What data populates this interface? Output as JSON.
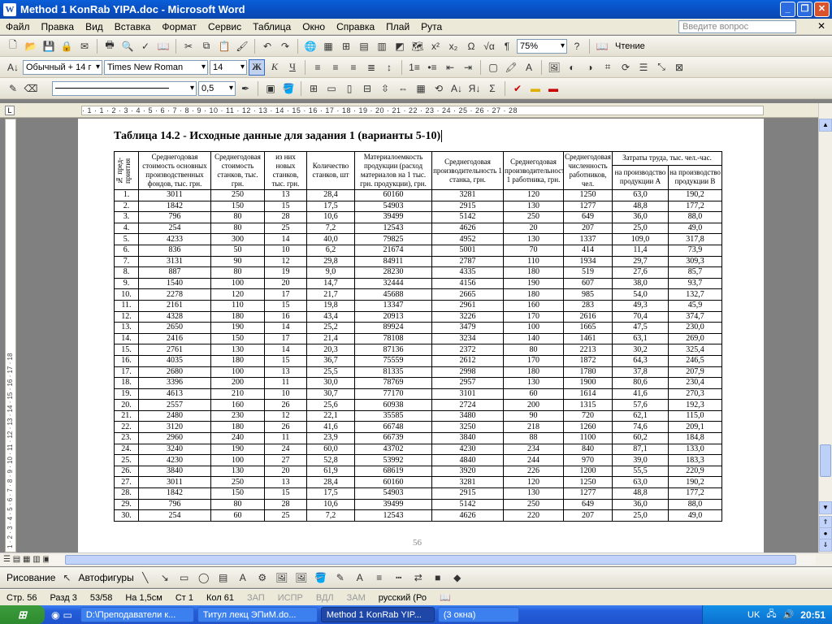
{
  "window": {
    "title": "Method 1 KonRab YIPA.doc - Microsoft Word",
    "app_icon": "W"
  },
  "menu": {
    "items": [
      "Файл",
      "Правка",
      "Вид",
      "Вставка",
      "Формат",
      "Сервис",
      "Таблица",
      "Окно",
      "Справка",
      "Плай",
      "Рута"
    ],
    "help_placeholder": "Введите вопрос"
  },
  "toolbar": {
    "zoom": "75%",
    "read_label": "Чтение",
    "style": "Обычный + 14 г",
    "font": "Times New Roman",
    "size": "14",
    "bold": "Ж",
    "italic": "К",
    "underline": "Ч",
    "line_width": "0,5",
    "accent_color": "#316ac5"
  },
  "ruler": {
    "marks": "· 1 · 1 · 2 · 3 · 4 · 5 · 6 · 7 · 8 · 9 · 10 · 11 · 12 · 13 · 14 · 15 · 16 · 17 · 18 · 19 · 20 · 21 · 22 · 23 · 24 · 25 · 26 · 27 · 28",
    "vmarks": "1 · 2 · 3 · 4 · 5 · 6 · 7 · 8 · 9 · 10 · 11 · 12 · 13 · 14 · 15 · 16 · 17 · 18"
  },
  "document": {
    "heading": "Таблица 14.2 - Исходные данные для задания 1 (варианты 5-10)",
    "page_number": "56",
    "headers": {
      "c1": "№ пред-приятия",
      "c2": "Среднегодовая стоимость основных производственных фондов, тыс. грн.",
      "c3": "Среднегодовая стоимость станков, тыс. грн.",
      "c4": "из них новых станков, тыс. грн.",
      "c5": "Количество станков, шт",
      "c6": "Материалоемкость продукции (расход материалов на 1 тыс. грн. продукции), грн.",
      "c7": "Среднегодовая производительность 1 станка, грн.",
      "c8": "Среднегодовая производительность 1 работника, грн.",
      "c9": "Среднегодовая численность работников, чел.",
      "c10": "Затраты труда, тыс. чел.-час.",
      "c10a": "на производство продукции А",
      "c10b": "на производство продукции В"
    },
    "rows": [
      [
        "1.",
        "3011",
        "250",
        "13",
        "28,4",
        "60160",
        "3281",
        "120",
        "1250",
        "63,0",
        "190,2"
      ],
      [
        "2.",
        "1842",
        "150",
        "15",
        "17,5",
        "54903",
        "2915",
        "130",
        "1277",
        "48,8",
        "177,2"
      ],
      [
        "3.",
        "796",
        "80",
        "28",
        "10,6",
        "39499",
        "5142",
        "250",
        "649",
        "36,0",
        "88,0"
      ],
      [
        "4.",
        "254",
        "80",
        "25",
        "7,2",
        "12543",
        "4626",
        "20",
        "207",
        "25,0",
        "49,0"
      ],
      [
        "5.",
        "4233",
        "300",
        "14",
        "40,0",
        "79825",
        "4952",
        "130",
        "1337",
        "109,0",
        "317,8"
      ],
      [
        "6.",
        "836",
        "50",
        "10",
        "6,2",
        "21674",
        "5001",
        "70",
        "414",
        "11,4",
        "73,9"
      ],
      [
        "7.",
        "3131",
        "90",
        "12",
        "29,8",
        "84911",
        "2787",
        "110",
        "1934",
        "29,7",
        "309,3"
      ],
      [
        "8.",
        "887",
        "80",
        "19",
        "9,0",
        "28230",
        "4335",
        "180",
        "519",
        "27,6",
        "85,7"
      ],
      [
        "9.",
        "1540",
        "100",
        "20",
        "14,7",
        "32444",
        "4156",
        "190",
        "607",
        "38,0",
        "93,7"
      ],
      [
        "10.",
        "2278",
        "120",
        "17",
        "21,7",
        "45688",
        "2665",
        "180",
        "985",
        "54,0",
        "132,7"
      ],
      [
        "11.",
        "2161",
        "110",
        "15",
        "19,8",
        "13347",
        "2961",
        "160",
        "283",
        "49,3",
        "45,9"
      ],
      [
        "12.",
        "4328",
        "180",
        "16",
        "43,4",
        "20913",
        "3226",
        "170",
        "2616",
        "70,4",
        "374,7"
      ],
      [
        "13.",
        "2650",
        "190",
        "14",
        "25,2",
        "89924",
        "3479",
        "100",
        "1665",
        "47,5",
        "230,0"
      ],
      [
        "14.",
        "2416",
        "150",
        "17",
        "21,4",
        "78108",
        "3234",
        "140",
        "1461",
        "63,1",
        "269,0"
      ],
      [
        "15.",
        "2761",
        "130",
        "14",
        "20,3",
        "87136",
        "2372",
        "80",
        "2213",
        "30,2",
        "325,4"
      ],
      [
        "16.",
        "4035",
        "180",
        "15",
        "36,7",
        "75559",
        "2612",
        "170",
        "1872",
        "64,3",
        "246,5"
      ],
      [
        "17.",
        "2680",
        "100",
        "13",
        "25,5",
        "81335",
        "2998",
        "180",
        "1780",
        "37,8",
        "207,9"
      ],
      [
        "18.",
        "3396",
        "200",
        "11",
        "30,0",
        "78769",
        "2957",
        "130",
        "1900",
        "80,6",
        "230,4"
      ],
      [
        "19.",
        "4613",
        "210",
        "10",
        "30,7",
        "77170",
        "3101",
        "60",
        "1614",
        "41,6",
        "270,3"
      ],
      [
        "20.",
        "2557",
        "160",
        "26",
        "25,6",
        "60938",
        "2724",
        "200",
        "1315",
        "57,6",
        "192,3"
      ],
      [
        "21.",
        "2480",
        "230",
        "12",
        "22,1",
        "35585",
        "3480",
        "90",
        "720",
        "62,1",
        "115,0"
      ],
      [
        "22.",
        "3120",
        "180",
        "26",
        "41,6",
        "66748",
        "3250",
        "218",
        "1260",
        "74,6",
        "209,1"
      ],
      [
        "23.",
        "2960",
        "240",
        "11",
        "23,9",
        "66739",
        "3840",
        "88",
        "1100",
        "60,2",
        "184,8"
      ],
      [
        "24.",
        "3240",
        "190",
        "24",
        "60,0",
        "43702",
        "4230",
        "234",
        "840",
        "87,1",
        "133,0"
      ],
      [
        "25.",
        "4230",
        "100",
        "27",
        "52,8",
        "53992",
        "4840",
        "244",
        "970",
        "39,0",
        "183,3"
      ],
      [
        "26.",
        "3840",
        "130",
        "20",
        "61,9",
        "68619",
        "3920",
        "226",
        "1200",
        "55,5",
        "220,9"
      ],
      [
        "27.",
        "3011",
        "250",
        "13",
        "28,4",
        "60160",
        "3281",
        "120",
        "1250",
        "63,0",
        "190,2"
      ],
      [
        "28.",
        "1842",
        "150",
        "15",
        "17,5",
        "54903",
        "2915",
        "130",
        "1277",
        "48,8",
        "177,2"
      ],
      [
        "29.",
        "796",
        "80",
        "28",
        "10,6",
        "39499",
        "5142",
        "250",
        "649",
        "36,0",
        "88,0"
      ],
      [
        "30.",
        "254",
        "60",
        "25",
        "7,2",
        "12543",
        "4626",
        "220",
        "207",
        "25,0",
        "49,0"
      ]
    ]
  },
  "drawing": {
    "draw_label": "Рисование",
    "autoshapes_label": "Автофигуры"
  },
  "status": {
    "page": "Стр. 56",
    "section": "Разд 3",
    "pages": "53/58",
    "at": "На 1,5см",
    "line": "Ст 1",
    "col": "Кол 61",
    "rec": "ЗАП",
    "trk": "ИСПР",
    "ext": "ВДЛ",
    "ovr": "ЗАМ",
    "lang": "русский (Ро"
  },
  "taskbar": {
    "tasks": [
      "D:\\Преподаватели к...",
      "Титул лекц ЭПиМ.do...",
      "Method 1 KonRab YIP...",
      "(3 окна)"
    ],
    "lang": "UK",
    "clock": "20:51"
  }
}
